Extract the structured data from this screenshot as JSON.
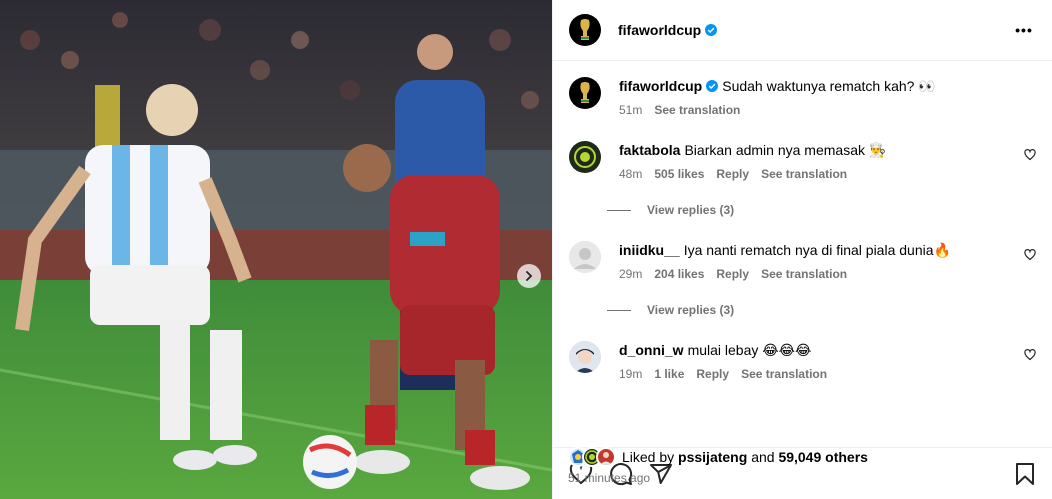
{
  "post": {
    "author": "fifaworldcup",
    "author_avatar_icon": "fifa-trophy-icon",
    "more_icon": "more-options-icon",
    "more_label": "•••",
    "next_icon": "chevron-right-icon"
  },
  "caption": {
    "username": "fifaworldcup",
    "text": "Sudah waktunya rematch kah? 👀",
    "time": "51m",
    "translate": "See translation"
  },
  "comments": [
    {
      "username": "faktabola",
      "text": "Biarkan admin nya memasak 👨‍🍳",
      "time": "48m",
      "likes": "505 likes",
      "reply": "Reply",
      "translate": "See translation",
      "view_replies": "View replies (3)",
      "avatar_color": "#1d2a1a"
    },
    {
      "username": "iniidku__",
      "text": "Iya nanti rematch nya di final piala dunia🔥",
      "time": "29m",
      "likes": "204 likes",
      "reply": "Reply",
      "translate": "See translation",
      "view_replies": "View replies (3)",
      "avatar_color": "#dbdbdb"
    },
    {
      "username": "d_onni_w",
      "text": "mulai lebay 😂😂😂",
      "time": "19m",
      "likes": "1 like",
      "reply": "Reply",
      "translate": "See translation",
      "avatar_color": "#cfd8e6"
    }
  ],
  "actions": {
    "like_icon": "heart-icon",
    "comment_icon": "comment-icon",
    "share_icon": "share-icon",
    "save_icon": "bookmark-icon"
  },
  "likes": {
    "prefix": "Liked by",
    "user": "pssijateng",
    "middle": "and",
    "others": "59,049 others"
  },
  "timestamp": "51 minutes ago",
  "colors": {
    "verified": "#0095f6",
    "secondary_text": "#737373",
    "border": "#efefef"
  }
}
